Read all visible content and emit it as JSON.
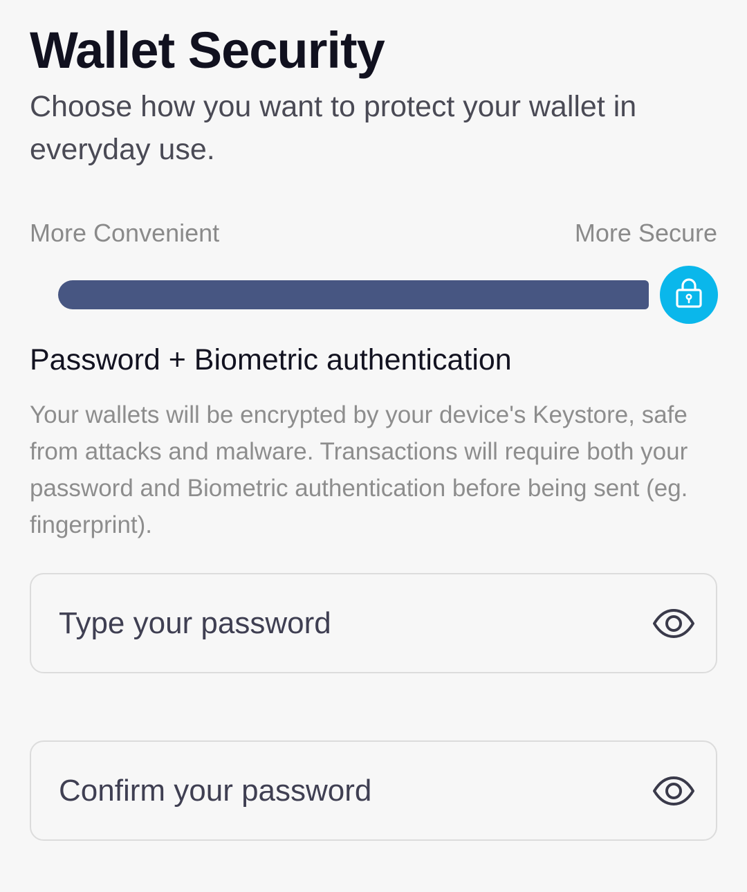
{
  "header": {
    "title": "Wallet Security",
    "subtitle": "Choose how you want to protect your wallet in everyday use."
  },
  "security_scale": {
    "left_label": "More Convenient",
    "right_label": "More Secure",
    "level": 1.0,
    "track_color": "#475682",
    "thumb_color": "#0ab7eb",
    "thumb_icon": "lock-icon"
  },
  "option": {
    "title": "Password + Biometric authentication",
    "description": "Your wallets will be encrypted by your device's Keystore, safe from attacks and malware. Transactions will require both your password and Biometric authentication before being sent (eg. fingerprint)."
  },
  "form": {
    "password": {
      "placeholder": "Type your password",
      "value": "",
      "toggle_icon": "eye-icon"
    },
    "confirm_password": {
      "placeholder": "Confirm your password",
      "value": "",
      "toggle_icon": "eye-icon"
    }
  }
}
